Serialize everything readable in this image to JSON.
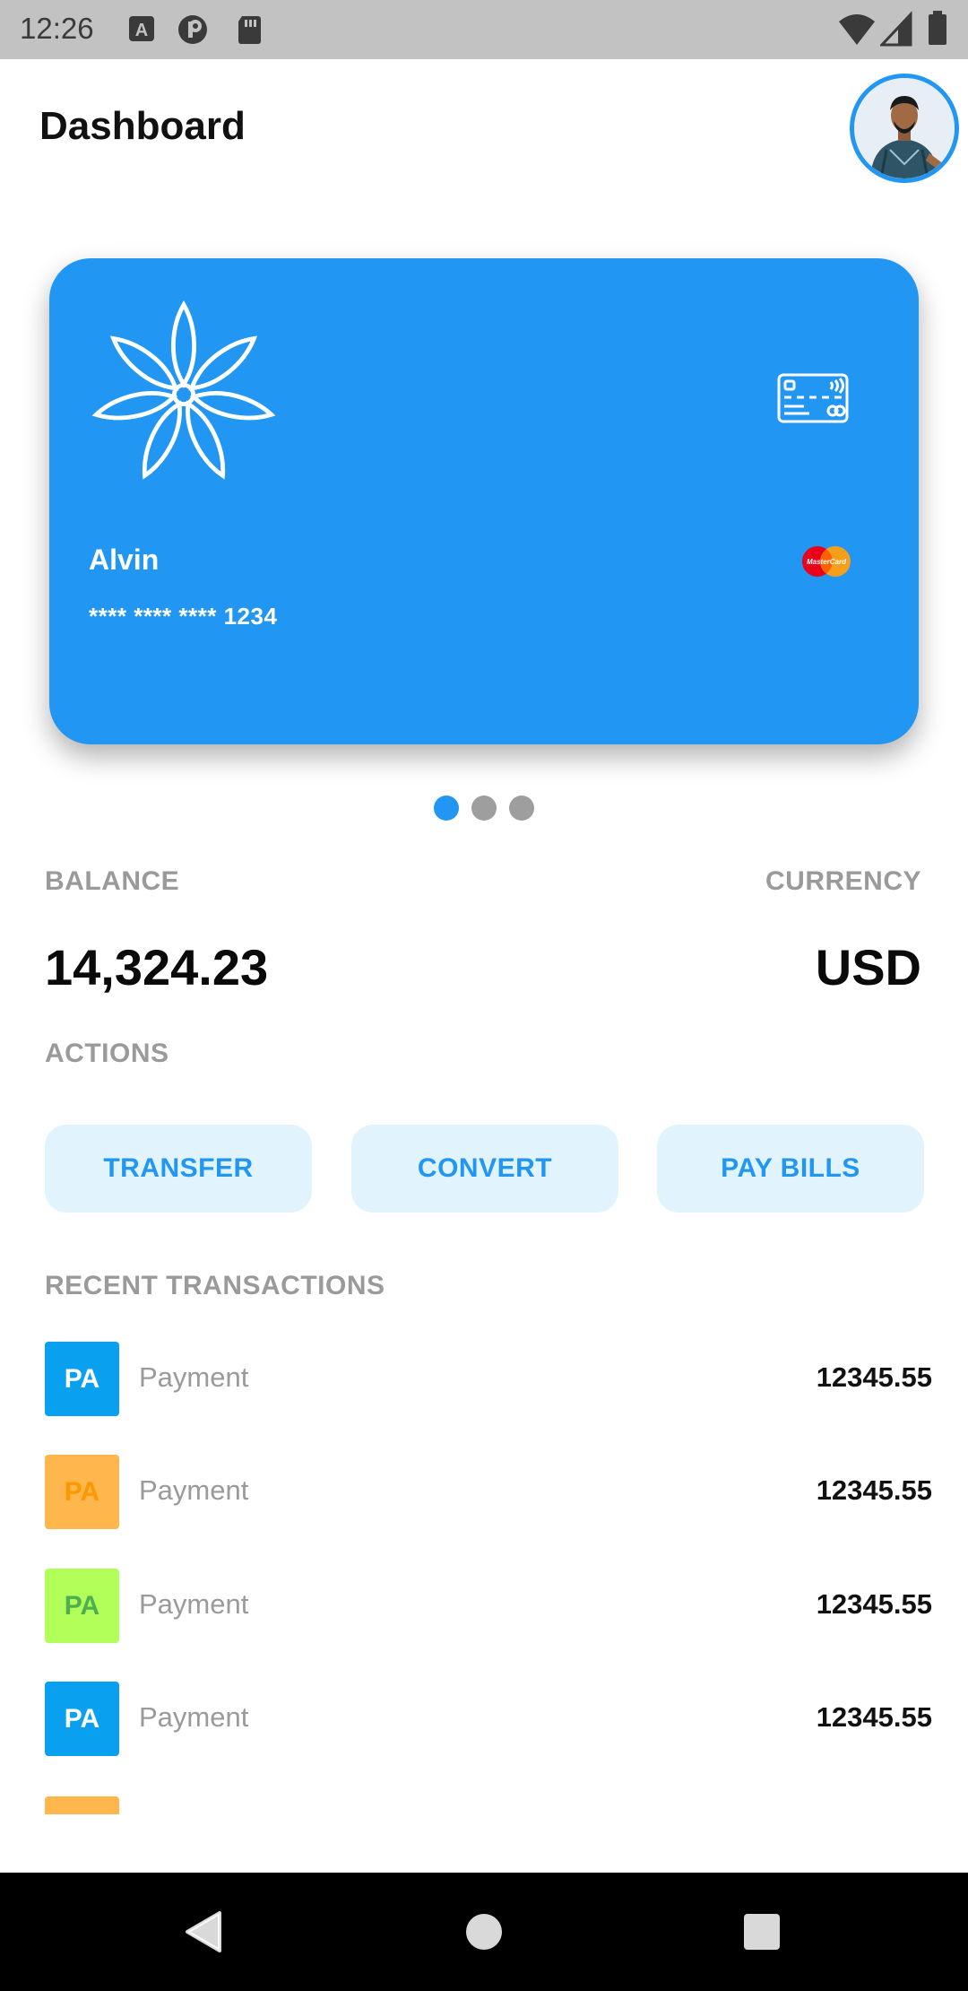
{
  "status_bar": {
    "time": "12:26"
  },
  "header": {
    "title": "Dashboard"
  },
  "card": {
    "holder_name": "Alvin",
    "number": "**** **** **** 1234",
    "network_logo_text": "MasterCard"
  },
  "pager": {
    "count": 3,
    "active_index": 0
  },
  "balance": {
    "balance_label": "BALANCE",
    "balance_value": "14,324.23",
    "currency_label": "CURRENCY",
    "currency_value": "USD"
  },
  "actions": {
    "label": "ACTIONS",
    "buttons": [
      {
        "label": "TRANSFER"
      },
      {
        "label": "CONVERT"
      },
      {
        "label": "PAY BILLS"
      }
    ]
  },
  "transactions": {
    "label": "RECENT TRANSACTIONS",
    "items": [
      {
        "initials": "PA",
        "label": "Payment",
        "amount": "12345.55",
        "bg": "#0aa0f0",
        "fg": "#ffffff"
      },
      {
        "initials": "PA",
        "label": "Payment",
        "amount": "12345.55",
        "bg": "#ffb74d",
        "fg": "#ff9800"
      },
      {
        "initials": "PA",
        "label": "Payment",
        "amount": "12345.55",
        "bg": "#b2ff59",
        "fg": "#4caf50"
      },
      {
        "initials": "PA",
        "label": "Payment",
        "amount": "12345.55",
        "bg": "#0aa0f0",
        "fg": "#ffffff"
      }
    ]
  },
  "colors": {
    "accent": "#2196f3",
    "action_bg": "#e1f3fd",
    "label_grey": "#9a9a9a"
  }
}
